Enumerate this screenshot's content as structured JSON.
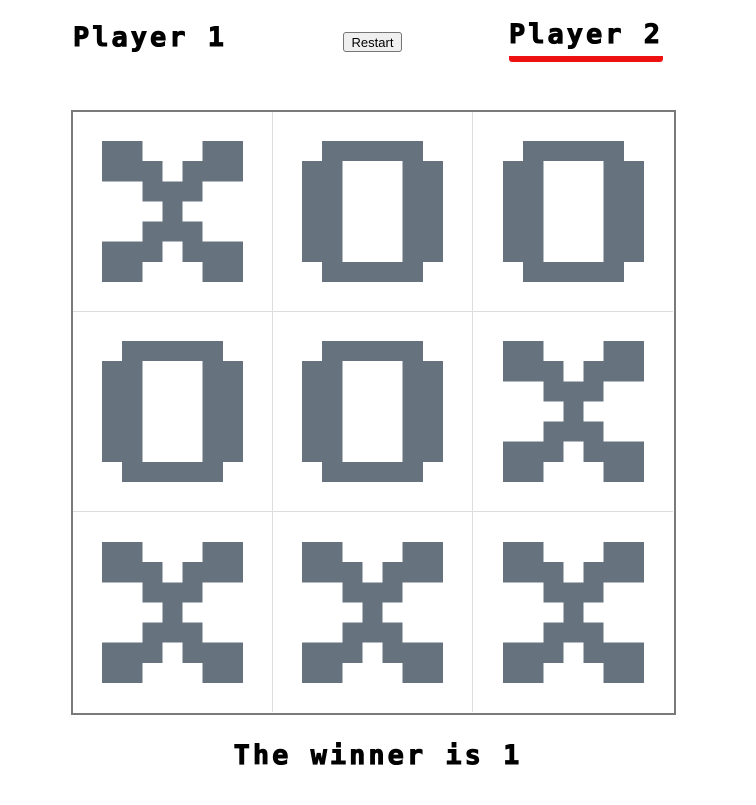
{
  "players": {
    "player1_label": "Player 1",
    "player2_label": "Player 2",
    "active_player": 2
  },
  "controls": {
    "restart_label": "Restart"
  },
  "board": {
    "cells": [
      "X",
      "O",
      "O",
      "O",
      "O",
      "X",
      "X",
      "X",
      "X"
    ]
  },
  "status": {
    "message": "The winner is 1"
  },
  "colors": {
    "mark": "#66737f",
    "active_underline": "#ee1111",
    "board_border": "#7a7a7a",
    "cell_divider": "#dddddd"
  }
}
